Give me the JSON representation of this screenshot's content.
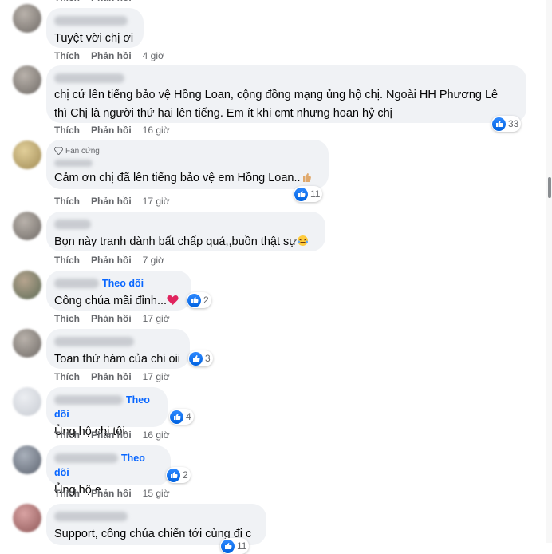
{
  "labels": {
    "like": "Thích",
    "reply": "Phản hồi",
    "follow": "Theo dõi",
    "fan_badge": "Fan cứng"
  },
  "comments": [
    {
      "text": "Tuyệt vời chị ơi",
      "time": "4 giờ",
      "likes": ""
    },
    {
      "line1": "chị cứ lên tiếng bảo vệ Hồng Loan, cộng đồng mạng ủng hộ chị. Ngoài HH Phương Lê",
      "line2": "thì Chị là người thứ hai lên tiếng. Em ít khi cmt nhưng hoan hỷ chị",
      "time": "16 giờ",
      "likes": "33"
    },
    {
      "text": "Cảm ơn chị đã lên tiếng bảo vệ em Hồng Loan..",
      "time": "17 giờ",
      "likes": "11"
    },
    {
      "text": "Bọn này tranh dành bất chấp quá,,buồn thật sự",
      "time": "7 giờ",
      "likes": ""
    },
    {
      "text": "Công chúa mãi đỉnh...",
      "time": "17 giờ",
      "likes": "2"
    },
    {
      "text": "Toan thứ hám của chi oii",
      "time": "17 giờ",
      "likes": "3"
    },
    {
      "text": "Ủng hộ chị tôi",
      "time": "16 giờ",
      "likes": "4"
    },
    {
      "text": "Ủng hộ e",
      "time": "15 giờ",
      "likes": "2"
    },
    {
      "text": "Support, công chúa chiến tới cùng đi c",
      "time": "",
      "likes": "11"
    }
  ]
}
